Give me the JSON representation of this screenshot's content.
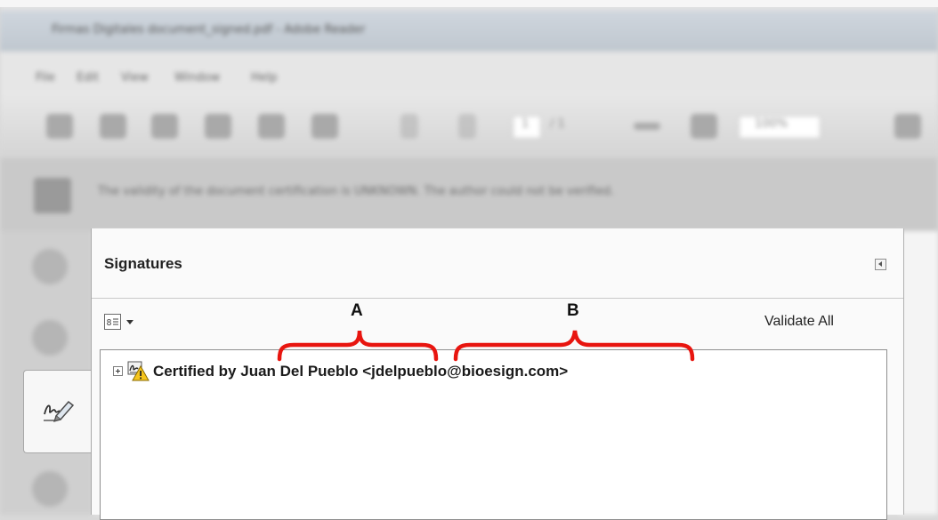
{
  "app": {
    "title": "Firmas Digitales document_signed.pdf - Adobe Reader",
    "menu": [
      "File",
      "Edit",
      "View",
      "Window",
      "Help"
    ],
    "toolbar": {
      "page_current": "1",
      "page_total": "/ 1",
      "zoom": "100%"
    },
    "message": "The validity of the document certification is UNKNOWN. The author could not be verified."
  },
  "panel": {
    "title": "Signatures",
    "validate_all_label": "Validate All",
    "signatures": [
      {
        "text": "Certified by Juan  Del Pueblo <jdelpueblo@bioesign.com>",
        "status": "unknown"
      }
    ]
  },
  "annotations": {
    "label_a": "A",
    "label_b": "B",
    "color": "#e8150f"
  },
  "icons": {
    "signatures_tab": "signature-pen-icon",
    "options": "options-menu-icon",
    "collapse": "collapse-panel-icon",
    "expand": "expand-tree-icon",
    "certified": "certified-warning-icon"
  }
}
